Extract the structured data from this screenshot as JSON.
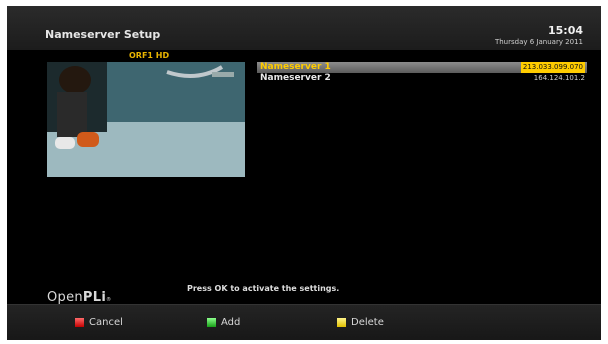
{
  "header": {
    "title": "Nameserver Setup",
    "time": "15:04",
    "date": "Thursday 6 January 2011"
  },
  "channel": {
    "name": "ORF1 HD"
  },
  "list": {
    "items": [
      {
        "label": "Nameserver 1",
        "value": "213.033.099.070",
        "selected": true
      },
      {
        "label": "Nameserver 2",
        "value": "164.124.101.2",
        "selected": false
      }
    ]
  },
  "hint": "Press OK to activate the settings.",
  "logo": {
    "main": "Open",
    "bold": "PLi",
    "mark": "®"
  },
  "footer": {
    "cancel_label": "Cancel",
    "add_label": "Add",
    "delete_label": "Delete"
  },
  "colors": {
    "red_key": "#d00000",
    "green_key": "#20b020",
    "yellow_key": "#f0d000",
    "highlight": "#ffcc00"
  }
}
